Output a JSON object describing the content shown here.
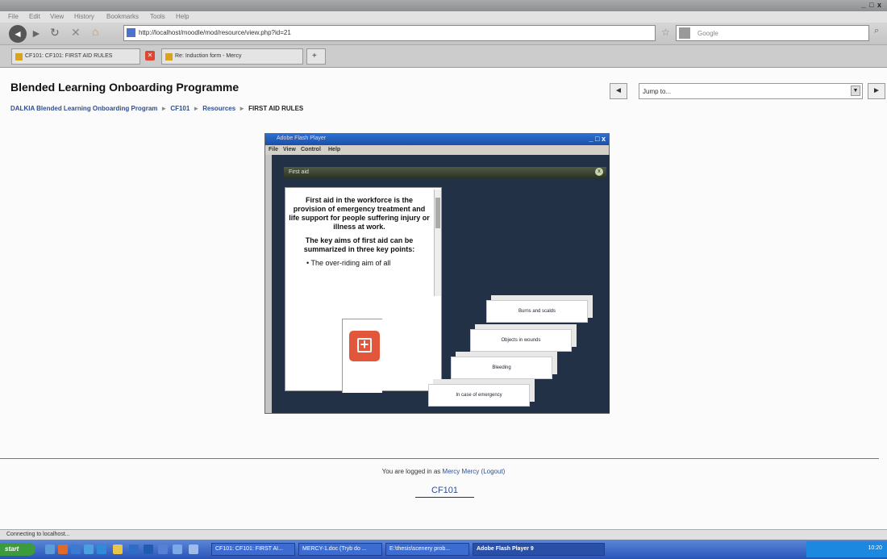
{
  "browser": {
    "window_title": "",
    "window_controls": "_ □ x",
    "menu": [
      "File",
      "Edit",
      "View",
      "History",
      "Bookmarks",
      "Tools",
      "Help"
    ],
    "url": "http://localhost/moodle/mod/resource/view.php?id=21",
    "search_placeholder": "Google",
    "tabs": [
      {
        "label": "CF101: CF101: FIRST AID RULES"
      },
      {
        "label": "Re: Induction form - Mercy"
      }
    ]
  },
  "page": {
    "title": "Blended Learning Onboarding Programme",
    "jump_placeholder": "Jump to...",
    "prev_label": "◄",
    "next_label": "►",
    "breadcrumbs": [
      "DALKIA Blended Learning Onboarding Program",
      "CF101",
      "Resources"
    ],
    "breadcrumb_current": "FIRST AID RULES",
    "breadcrumb_sep": "►"
  },
  "flash": {
    "window_title": "Adobe Flash Player",
    "menu": [
      "File",
      "View",
      "Control",
      "Help"
    ],
    "window_controls": "_ □ x",
    "header_label": "First aid",
    "close_label": "x",
    "card_paragraphs": [
      "First aid in the workforce is the provision of emergency treatment and life support for people suffering injury or illness at work.",
      "The key aims of first aid can be summarized in three key points:"
    ],
    "card_bullet": "• The over-riding aim of all",
    "steps": [
      "Burns and scalds",
      "Objects in wounds",
      "Bleeding",
      "In case of emergency"
    ]
  },
  "footer": {
    "login_prefix": "You are logged in as",
    "user": "Mercy Mercy",
    "logout": "(Logout)",
    "course": "CF101"
  },
  "status": {
    "text": "Connecting to localhost..."
  },
  "taskbar": {
    "start": "start",
    "items": [
      "CF101: CF101: FIRST AI...",
      "MERCY-1.doc (Tryb do ...",
      "E:\\thesis\\scenery prob...",
      "Adobe Flash Player 9"
    ],
    "tray_time": "10:20"
  }
}
